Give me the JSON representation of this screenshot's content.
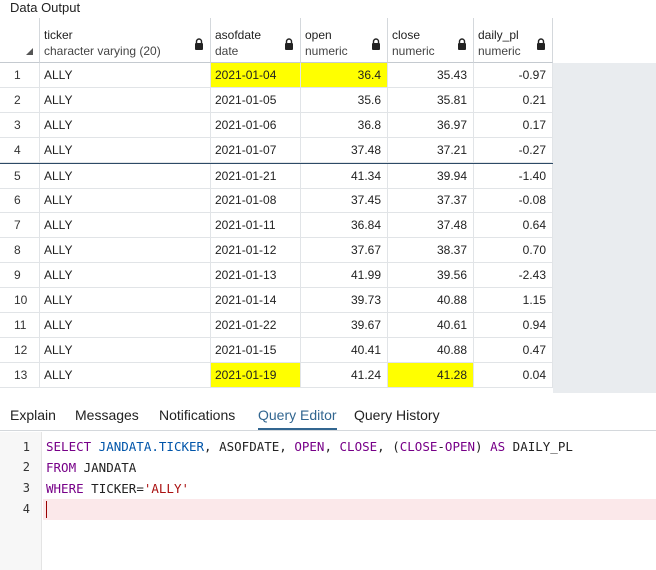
{
  "panel_title": "Data Output",
  "columns": [
    {
      "name": "ticker",
      "type": "character varying (20)"
    },
    {
      "name": "asofdate",
      "type": "date"
    },
    {
      "name": "open",
      "type": "numeric"
    },
    {
      "name": "close",
      "type": "numeric"
    },
    {
      "name": "daily_pl",
      "type": "numeric"
    }
  ],
  "rows": [
    {
      "n": "1",
      "ticker": "ALLY",
      "asofdate": "2021-01-04",
      "open": "36.4",
      "close": "35.43",
      "daily_pl": "-0.97"
    },
    {
      "n": "2",
      "ticker": "ALLY",
      "asofdate": "2021-01-05",
      "open": "35.6",
      "close": "35.81",
      "daily_pl": "0.21"
    },
    {
      "n": "3",
      "ticker": "ALLY",
      "asofdate": "2021-01-06",
      "open": "36.8",
      "close": "36.97",
      "daily_pl": "0.17"
    },
    {
      "n": "4",
      "ticker": "ALLY",
      "asofdate": "2021-01-07",
      "open": "37.48",
      "close": "37.21",
      "daily_pl": "-0.27"
    },
    {
      "n": "5",
      "ticker": "ALLY",
      "asofdate": "2021-01-21",
      "open": "41.34",
      "close": "39.94",
      "daily_pl": "-1.40"
    },
    {
      "n": "6",
      "ticker": "ALLY",
      "asofdate": "2021-01-08",
      "open": "37.45",
      "close": "37.37",
      "daily_pl": "-0.08"
    },
    {
      "n": "7",
      "ticker": "ALLY",
      "asofdate": "2021-01-11",
      "open": "36.84",
      "close": "37.48",
      "daily_pl": "0.64"
    },
    {
      "n": "8",
      "ticker": "ALLY",
      "asofdate": "2021-01-12",
      "open": "37.67",
      "close": "38.37",
      "daily_pl": "0.70"
    },
    {
      "n": "9",
      "ticker": "ALLY",
      "asofdate": "2021-01-13",
      "open": "41.99",
      "close": "39.56",
      "daily_pl": "-2.43"
    },
    {
      "n": "10",
      "ticker": "ALLY",
      "asofdate": "2021-01-14",
      "open": "39.73",
      "close": "40.88",
      "daily_pl": "1.15"
    },
    {
      "n": "11",
      "ticker": "ALLY",
      "asofdate": "2021-01-22",
      "open": "39.67",
      "close": "40.61",
      "daily_pl": "0.94"
    },
    {
      "n": "12",
      "ticker": "ALLY",
      "asofdate": "2021-01-15",
      "open": "40.41",
      "close": "40.88",
      "daily_pl": "0.47"
    },
    {
      "n": "13",
      "ticker": "ALLY",
      "asofdate": "2021-01-19",
      "open": "41.24",
      "close": "41.28",
      "daily_pl": "0.04"
    }
  ],
  "tabs": [
    {
      "label": "Explain"
    },
    {
      "label": "Messages"
    },
    {
      "label": "Notifications"
    },
    {
      "label": "Query Editor"
    },
    {
      "label": "Query History"
    }
  ],
  "active_tab": "Query Editor",
  "editor": {
    "line_numbers": [
      "1",
      "2",
      "3",
      "4"
    ],
    "line1": {
      "kw1": "SELECT",
      "tbl": " JANDATA.TICKER",
      "p1": ", ASOFDATE, ",
      "kw2": "OPEN",
      "p2": ", ",
      "kw3": "CLOSE",
      "p3": ", (",
      "kw4": "CLOSE",
      "p4": "-",
      "kw5": "OPEN",
      "p5": ") ",
      "kw6": "AS",
      "p6": " DAILY_PL"
    },
    "line2": {
      "kw1": "FROM",
      "p1": " JANDATA"
    },
    "line3": {
      "kw1": "WHERE",
      "p1": " TICKER=",
      "str": "'ALLY'"
    }
  },
  "colors": {
    "highlight": "#ffff00",
    "keyword": "#770088",
    "active_tab": "#326690",
    "filler": "#e9ecef"
  },
  "icons": {
    "lock": "lock-icon",
    "sort": "corner-triangle-icon"
  }
}
